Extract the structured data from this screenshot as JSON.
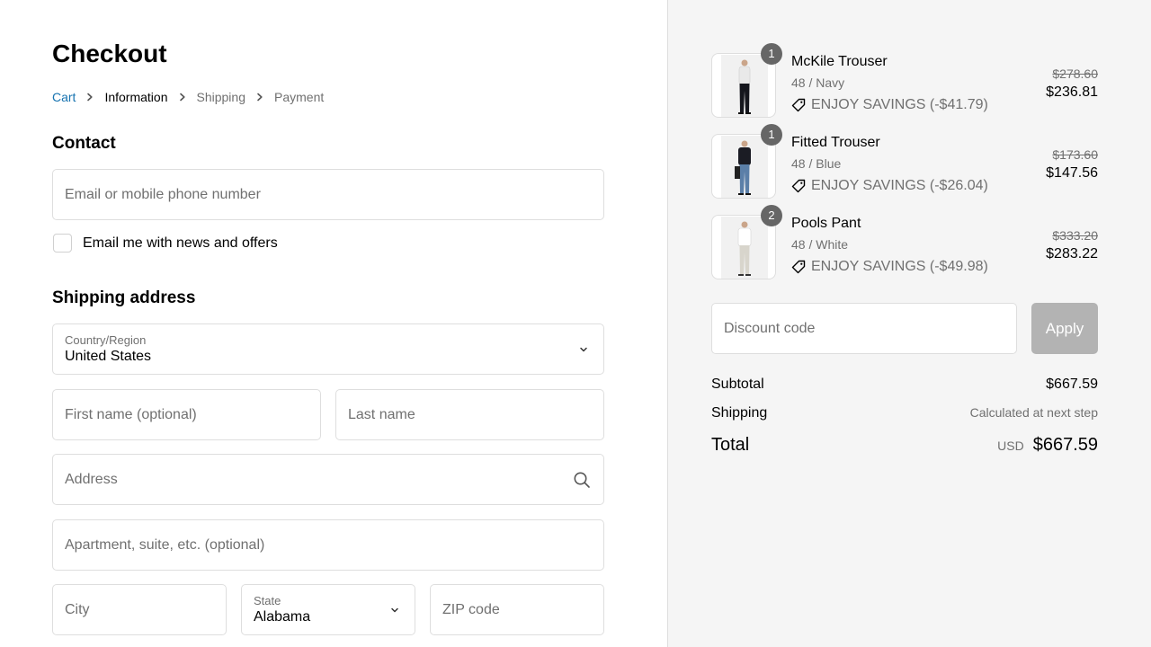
{
  "checkout": {
    "title": "Checkout",
    "breadcrumb": [
      "Cart",
      "Information",
      "Shipping",
      "Payment"
    ]
  },
  "contact": {
    "title": "Contact",
    "email_placeholder": "Email or mobile phone number",
    "newsletter_label": "Email me with news and offers"
  },
  "shipping": {
    "title": "Shipping address",
    "country_label": "Country/Region",
    "country_value": "United States",
    "first_name_placeholder": "First name (optional)",
    "last_name_placeholder": "Last name",
    "address_placeholder": "Address",
    "apartment_placeholder": "Apartment, suite, etc. (optional)",
    "city_placeholder": "City",
    "state_label": "State",
    "state_value": "Alabama",
    "zip_placeholder": "ZIP code"
  },
  "cart": {
    "items": [
      {
        "qty": "1",
        "name": "McKile Trouser",
        "variant": "48 / Navy",
        "savings": "ENJOY SAVINGS (-$41.79)",
        "old_price": "$278.60",
        "price": "$236.81",
        "top_color": "#e9e9e9",
        "pant_color": "#15161d"
      },
      {
        "qty": "1",
        "name": "Fitted Trouser",
        "variant": "48 / Blue",
        "savings": "ENJOY SAVINGS (-$26.04)",
        "old_price": "$173.60",
        "price": "$147.56",
        "top_color": "#1b1c24",
        "pant_color": "#5b7fa8"
      },
      {
        "qty": "2",
        "name": "Pools Pant",
        "variant": "48 / White",
        "savings": "ENJOY SAVINGS (-$49.98)",
        "old_price": "$333.20",
        "price": "$283.22",
        "top_color": "#ffffff",
        "pant_color": "#d8d5cc"
      }
    ]
  },
  "discount": {
    "placeholder": "Discount code",
    "apply_label": "Apply"
  },
  "summary": {
    "subtotal_label": "Subtotal",
    "subtotal_value": "$667.59",
    "shipping_label": "Shipping",
    "shipping_value": "Calculated at next step",
    "total_label": "Total",
    "currency": "USD",
    "total_value": "$667.59"
  },
  "colors": {
    "link": "#1773b0",
    "muted": "#707070",
    "apply_bg": "#b3b3b3",
    "panel_bg": "#f5f5f5"
  }
}
